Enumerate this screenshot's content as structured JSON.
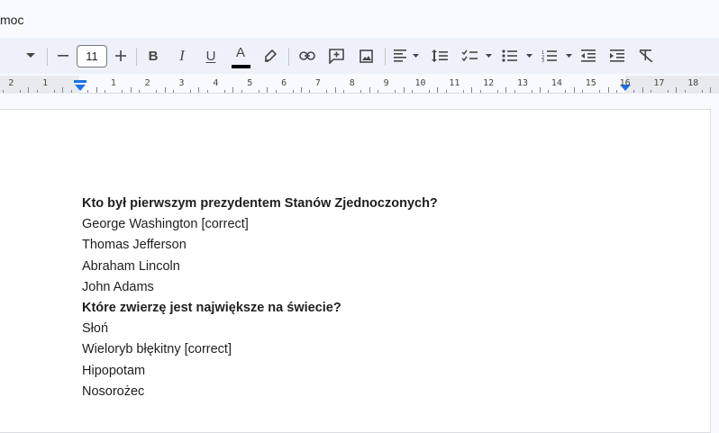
{
  "menubar": {
    "help_label": "moc"
  },
  "toolbar": {
    "font_size": "11",
    "bold_label": "B",
    "italic_label": "I",
    "underline_label": "U",
    "text_color_label": "A",
    "text_color": "#000000",
    "icons": [
      "chevron-down",
      "minus",
      "plus",
      "bold",
      "italic",
      "underline",
      "text-color",
      "highlighter",
      "link",
      "add-comment",
      "insert-image",
      "align-left",
      "line-spacing",
      "checklist",
      "bulleted-list",
      "numbered-list",
      "decrease-indent",
      "increase-indent",
      "clear-formatting"
    ]
  },
  "ruler": {
    "labels": [
      "2",
      "1",
      "1",
      "2",
      "3",
      "4",
      "5",
      "6",
      "7",
      "8",
      "9",
      "10",
      "11",
      "12",
      "13",
      "14",
      "15",
      "16",
      "17",
      "18"
    ],
    "accent": "#1a73e8"
  },
  "document": {
    "lines": [
      {
        "text": "Kto był pierwszym prezydentem Stanów Zjednoczonych?",
        "bold": true
      },
      {
        "text": "George Washington [correct]",
        "bold": false
      },
      {
        "text": "Thomas Jefferson",
        "bold": false
      },
      {
        "text": "Abraham Lincoln",
        "bold": false
      },
      {
        "text": "John Adams",
        "bold": false
      },
      {
        "text": "Które zwierzę jest największe na świecie?",
        "bold": true
      },
      {
        "text": "Słoń",
        "bold": false
      },
      {
        "text": "Wieloryb błękitny [correct]",
        "bold": false
      },
      {
        "text": "Hipopotam",
        "bold": false
      },
      {
        "text": "Nosorożec",
        "bold": false
      }
    ]
  }
}
